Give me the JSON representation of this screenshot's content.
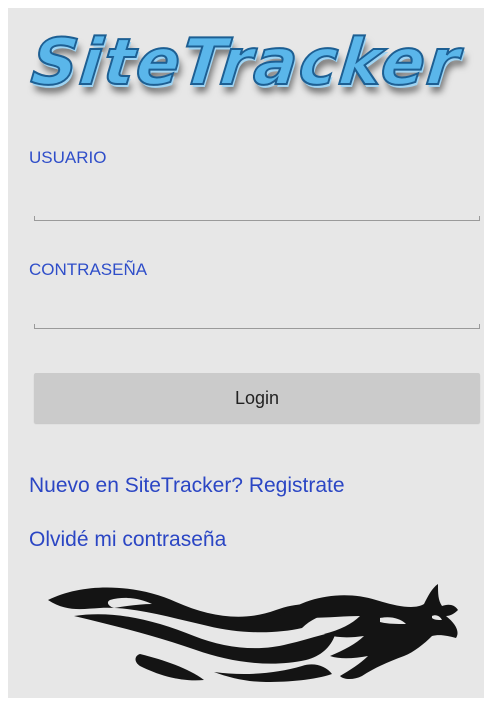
{
  "app": {
    "logo_text": "SiteTracker"
  },
  "form": {
    "username_label": "USUARIO",
    "username_value": "",
    "password_label": "CONTRASEÑA",
    "password_value": "",
    "login_label": "Login"
  },
  "links": {
    "register": "Nuevo en SiteTracker? Registrate",
    "forgot_password": "Olvidé mi contraseña"
  },
  "colors": {
    "background": "#e7e7e7",
    "label": "#2f4ec9",
    "link": "#2b46c4",
    "button": "#cbcbcb",
    "logo": "#5ab6ea"
  },
  "icons": {
    "mascot": "tribal-wolf-icon"
  }
}
